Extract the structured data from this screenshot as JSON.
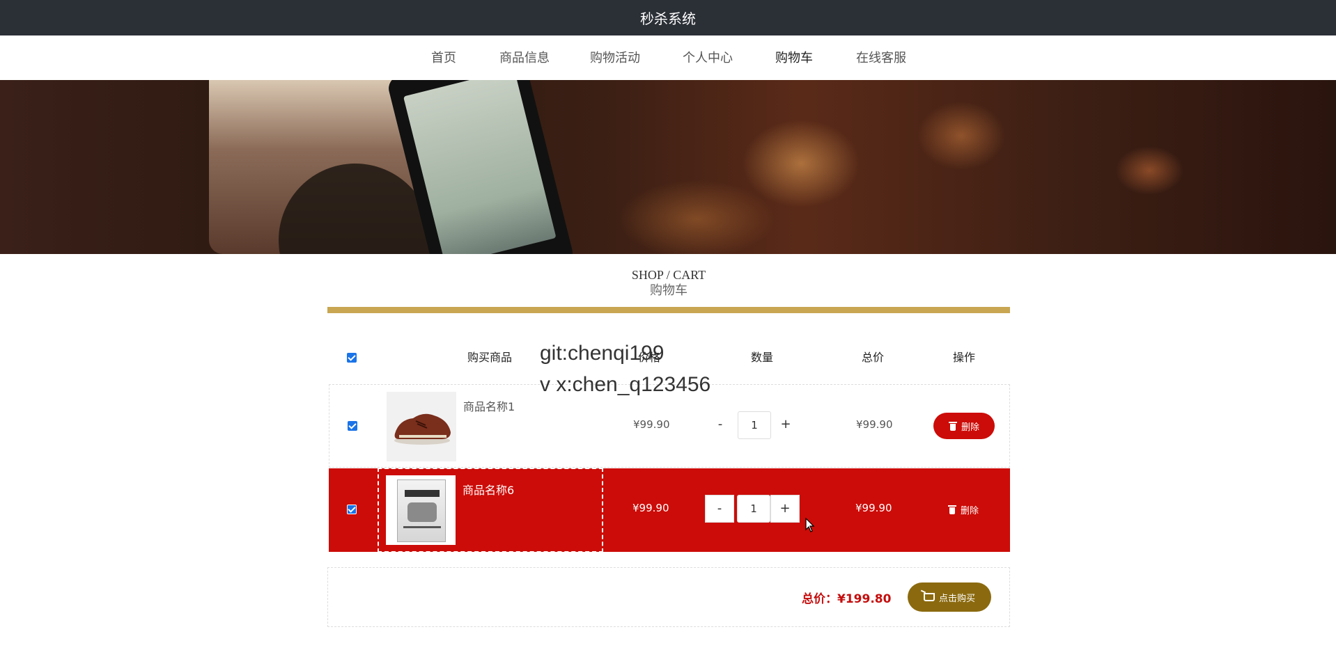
{
  "app": {
    "title": "秒杀系统"
  },
  "nav": {
    "items": [
      {
        "label": "首页"
      },
      {
        "label": "商品信息"
      },
      {
        "label": "购物活动"
      },
      {
        "label": "个人中心"
      },
      {
        "label": "购物车",
        "active": true
      },
      {
        "label": "在线客服"
      }
    ]
  },
  "section": {
    "title_en": "SHOP / CART",
    "title_zh": "购物车"
  },
  "cart": {
    "headers": {
      "product": "购买商品",
      "price": "价格",
      "quantity": "数量",
      "total": "总价",
      "action": "操作"
    },
    "items": [
      {
        "name": "商品名称1",
        "price": "¥99.90",
        "quantity": "1",
        "total": "¥99.90",
        "delete_label": "删除",
        "checked": true,
        "thumbnail": "shoe"
      },
      {
        "name": "商品名称6",
        "price": "¥99.90",
        "quantity": "1",
        "total": "¥99.90",
        "delete_label": "删除",
        "checked": true,
        "thumbnail": "book",
        "highlighted": true
      }
    ],
    "qty_minus": "-",
    "qty_plus": "+",
    "summary_label": "总价：¥199.80",
    "buy_label": "点击购买"
  },
  "watermark": {
    "line1": "git:chenqi199",
    "line2": "v x:chen_q123456"
  },
  "colors": {
    "accent_gold": "#c8a652",
    "danger_red": "#cc0c08",
    "buy_brown": "#8b6a0f",
    "topbar": "#2b2f36"
  }
}
